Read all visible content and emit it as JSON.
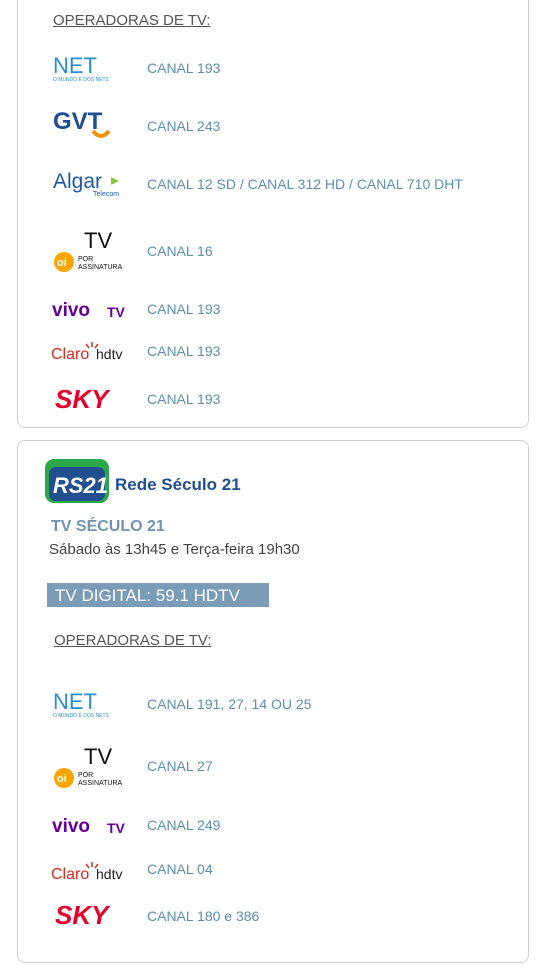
{
  "card1": {
    "section_title": "OPERADORAS DE TV:",
    "operators": [
      {
        "logo": "net-logo",
        "canal": "CANAL 193"
      },
      {
        "logo": "gvt-logo",
        "canal": "CANAL 243"
      },
      {
        "logo": "algar-logo",
        "canal": "CANAL 12 SD / CANAL 312 HD / CANAL 710 DHT"
      },
      {
        "logo": "oi-tv-logo",
        "canal": "CANAL 16"
      },
      {
        "logo": "vivo-tv-logo",
        "canal": "CANAL 193"
      },
      {
        "logo": "claro-hdtv-logo",
        "canal": "CANAL 193"
      },
      {
        "logo": "sky-logo",
        "canal": "CANAL 193"
      }
    ]
  },
  "card2": {
    "logo": {
      "badge": "RS21",
      "name": "Rede Século 21"
    },
    "tv_title": "TV SÉCULO 21",
    "schedule": "Sábado às 13h45 e Terça-feira 19h30",
    "digital": "TV DIGITAL: 59.1 HDTV",
    "section_title": "OPERADORAS DE TV:",
    "operators": [
      {
        "logo": "net-logo",
        "canal": "CANAL 191, 27, 14 OU 25"
      },
      {
        "logo": "oi-tv-logo",
        "canal": "CANAL 27"
      },
      {
        "logo": "vivo-tv-logo",
        "canal": "CANAL 249"
      },
      {
        "logo": "claro-hdtv-logo",
        "canal": "CANAL 04"
      },
      {
        "logo": "sky-logo",
        "canal": "CANAL 180 e 386"
      }
    ]
  },
  "logo_text": {
    "net": "NET",
    "net_tag": "O MUNDO É DOS NETS",
    "gvt": "GVT",
    "algar": "Algar",
    "algar_tag": "Telecom",
    "oi_tv": "TV",
    "oi": "oi",
    "oi_tag1": "POR",
    "oi_tag2": "ASSINATURA",
    "vivo": "vivo",
    "vivo_tv": "TV",
    "claro": "Claro",
    "hdtv": "hdtv",
    "sky": "SKY"
  },
  "colors": {
    "net_blue": "#2a8fd0",
    "gvt_blue": "#1d4e8f",
    "gvt_orange": "#f39200",
    "algar_blue": "#1e5aa8",
    "oi_yellow": "#f7a600",
    "vivo_purple": "#660099",
    "claro_red": "#d52b1e",
    "sky_red": "#e4002b",
    "canal_text": "#5c8fb3",
    "digital_bg": "#7b9cb7",
    "rs21_green": "#2aa84a",
    "rs21_blue": "#1f4f8f"
  }
}
